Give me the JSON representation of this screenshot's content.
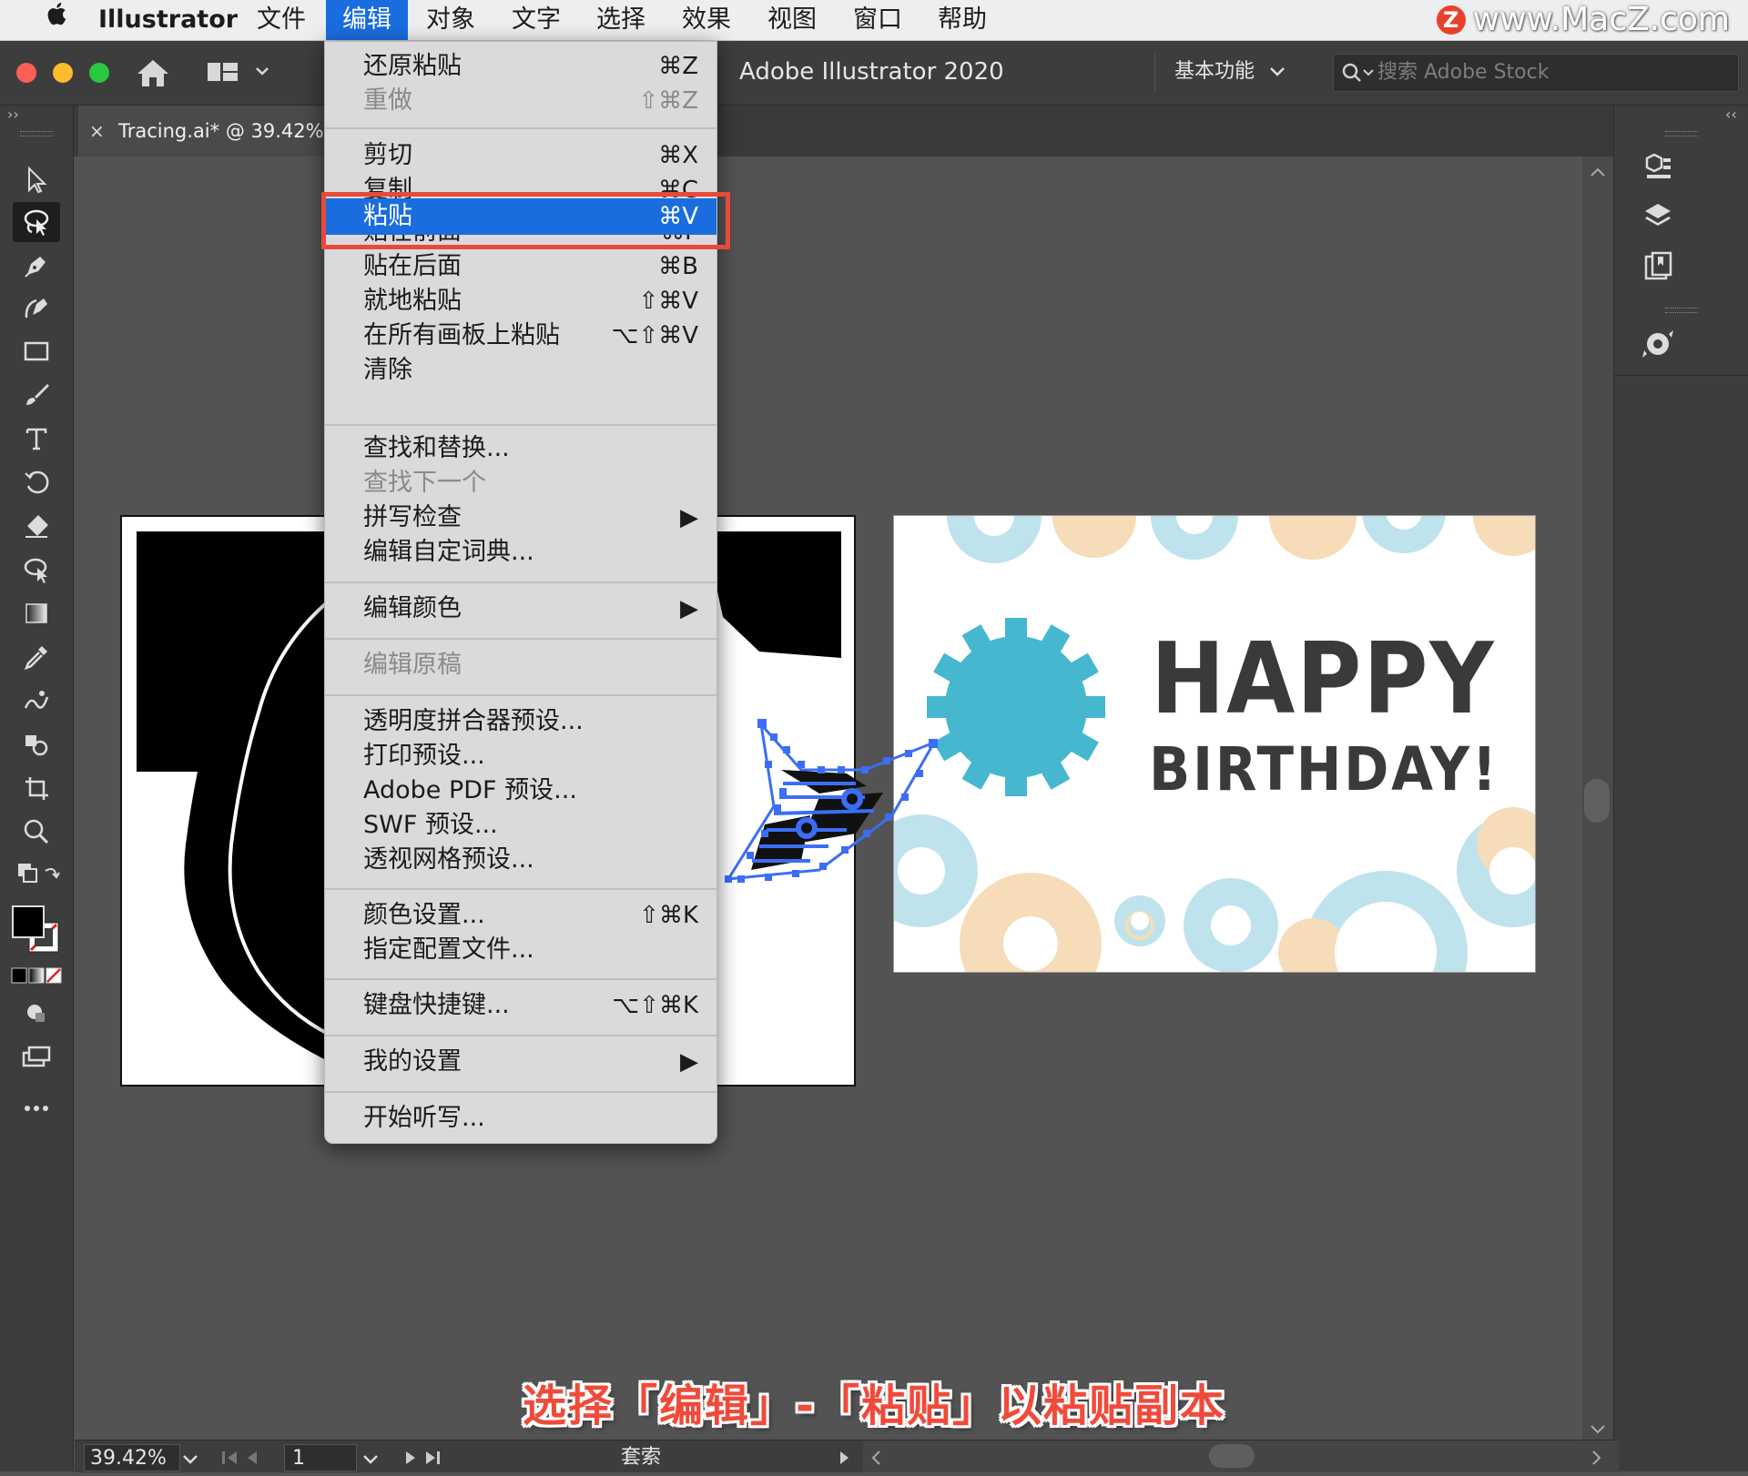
{
  "menubar": {
    "app_name": "Illustrator",
    "items": [
      "文件",
      "编辑",
      "对象",
      "文字",
      "选择",
      "效果",
      "视图",
      "窗口",
      "帮助"
    ],
    "active": "编辑"
  },
  "watermark": {
    "badge": "Z",
    "text": "www.MacZ.com"
  },
  "appbar": {
    "title": "Adobe Illustrator 2020",
    "workspace": "基本功能",
    "search_placeholder": "搜索 Adobe Stock"
  },
  "tabs": {
    "expand_left": "››",
    "expand_right": "‹‹",
    "close": "×",
    "document": "Tracing.ai* @ 39.42% ("
  },
  "edit_menu": {
    "items": [
      {
        "label": "还原粘贴",
        "shortcut": "⌘Z"
      },
      {
        "label": "重做",
        "shortcut": "⇧⌘Z"
      },
      {
        "label": "剪切",
        "shortcut": "⌘X"
      },
      {
        "label": "复制",
        "shortcut": "⌘C"
      },
      {
        "label": "粘贴",
        "shortcut": "⌘V"
      },
      {
        "label": "贴在前面",
        "shortcut": "⌘F"
      },
      {
        "label": "贴在后面",
        "shortcut": "⌘B"
      },
      {
        "label": "就地粘贴",
        "shortcut": "⇧⌘V"
      },
      {
        "label": "在所有画板上粘贴",
        "shortcut": "⌥⇧⌘V"
      },
      {
        "label": "清除",
        "shortcut": ""
      },
      {
        "label": "查找和替换...",
        "shortcut": ""
      },
      {
        "label": "查找下一个",
        "shortcut": ""
      },
      {
        "label": "拼写检查",
        "shortcut": "▶"
      },
      {
        "label": "编辑自定词典...",
        "shortcut": ""
      },
      {
        "label": "编辑颜色",
        "shortcut": "▶"
      },
      {
        "label": "编辑原稿",
        "shortcut": ""
      },
      {
        "label": "透明度拼合器预设...",
        "shortcut": ""
      },
      {
        "label": "打印预设...",
        "shortcut": ""
      },
      {
        "label": "Adobe PDF 预设...",
        "shortcut": ""
      },
      {
        "label": "SWF 预设...",
        "shortcut": ""
      },
      {
        "label": "透视网格预设...",
        "shortcut": ""
      },
      {
        "label": "颜色设置...",
        "shortcut": "⇧⌘K"
      },
      {
        "label": "指定配置文件...",
        "shortcut": ""
      },
      {
        "label": "键盘快捷键...",
        "shortcut": "⌥⇧⌘K"
      },
      {
        "label": "我的设置",
        "shortcut": "▶"
      },
      {
        "label": "开始听写...",
        "shortcut": ""
      }
    ],
    "highlighted": "粘贴",
    "disabled": [
      "重做",
      "查找下一个",
      "编辑原稿"
    ]
  },
  "card": {
    "line1": "HAPPY",
    "line2": "BIRTHDAY!"
  },
  "caption": "选择「编辑」-「粘贴」以粘贴副本",
  "statusbar": {
    "zoom": "39.42%",
    "artboard": "1",
    "tool": "套索"
  },
  "colors": {
    "accent": "#1a6ddf",
    "highlight_box": "#e74a3b",
    "gear_teal": "#45b8cf",
    "gear_light_blue": "#bfe3ec",
    "gear_peach": "#f6dcb8",
    "text_dark": "#3a3a3c",
    "path_selection": "#3b6ef5"
  }
}
